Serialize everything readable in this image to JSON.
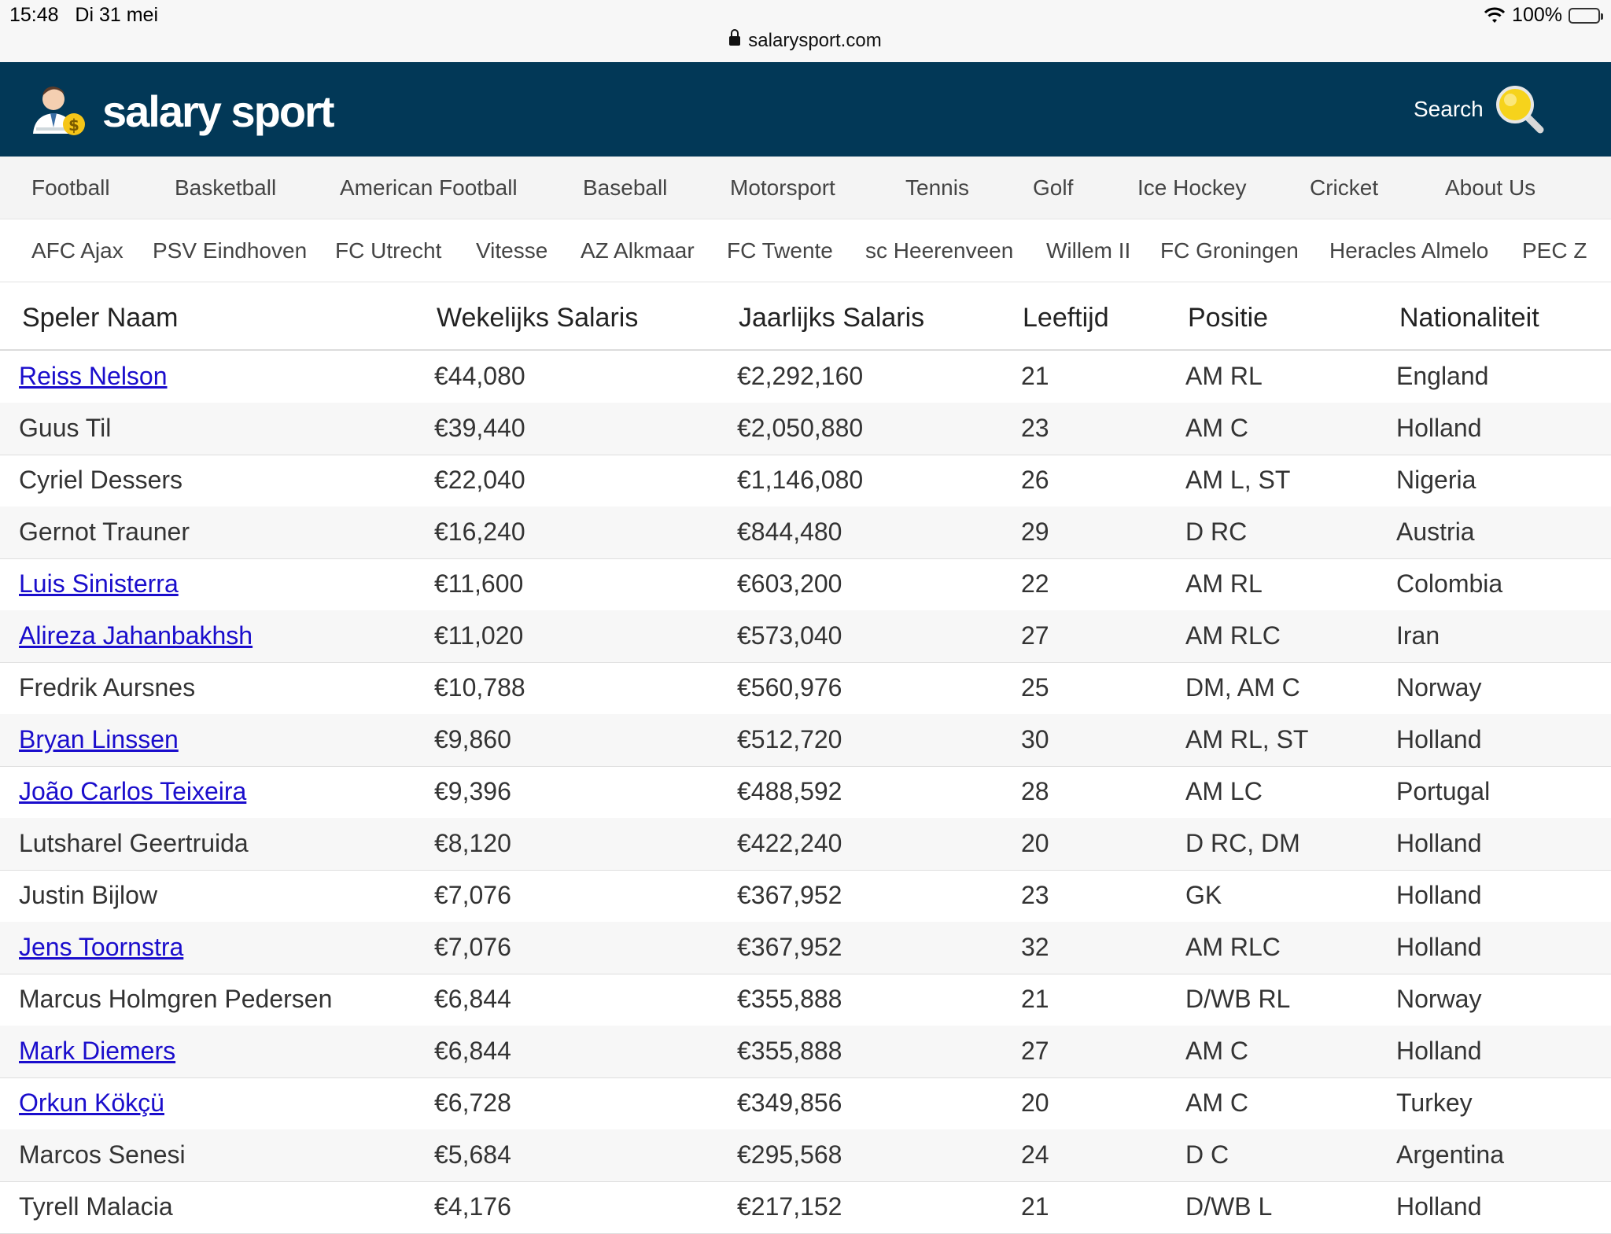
{
  "status_bar": {
    "time": "15:48",
    "date": "Di 31 mei",
    "battery": "100%",
    "url": "salarysport.com"
  },
  "header": {
    "logo_text": "salary sport",
    "search_label": "Search"
  },
  "nav_sports": [
    "Football",
    "Basketball",
    "American Football",
    "Baseball",
    "Motorsport",
    "Tennis",
    "Golf",
    "Ice Hockey",
    "Cricket",
    "About Us"
  ],
  "nav_clubs": [
    "AFC Ajax",
    "PSV Eindhoven",
    "FC Utrecht",
    "Vitesse",
    "AZ Alkmaar",
    "FC Twente",
    "sc Heerenveen",
    "Willem II",
    "FC Groningen",
    "Heracles Almelo",
    "PEC Z"
  ],
  "table": {
    "headers": [
      "Speler Naam",
      "Wekelijks Salaris",
      "Jaarlijks Salaris",
      "Leeftijd",
      "Positie",
      "Nationaliteit"
    ],
    "rows": [
      {
        "name": "Reiss Nelson",
        "link": true,
        "weekly": "€44,080",
        "yearly": "€2,292,160",
        "age": "21",
        "position": "AM RL",
        "nationality": "England"
      },
      {
        "name": "Guus Til",
        "link": false,
        "weekly": "€39,440",
        "yearly": "€2,050,880",
        "age": "23",
        "position": "AM C",
        "nationality": "Holland"
      },
      {
        "name": "Cyriel Dessers",
        "link": false,
        "weekly": "€22,040",
        "yearly": "€1,146,080",
        "age": "26",
        "position": "AM L, ST",
        "nationality": "Nigeria"
      },
      {
        "name": "Gernot Trauner",
        "link": false,
        "weekly": "€16,240",
        "yearly": "€844,480",
        "age": "29",
        "position": "D RC",
        "nationality": "Austria"
      },
      {
        "name": "Luis Sinisterra",
        "link": true,
        "weekly": "€11,600",
        "yearly": "€603,200",
        "age": "22",
        "position": "AM RL",
        "nationality": "Colombia"
      },
      {
        "name": "Alireza Jahanbakhsh",
        "link": true,
        "weekly": "€11,020",
        "yearly": "€573,040",
        "age": "27",
        "position": "AM RLC",
        "nationality": "Iran"
      },
      {
        "name": "Fredrik Aursnes",
        "link": false,
        "weekly": "€10,788",
        "yearly": "€560,976",
        "age": "25",
        "position": "DM, AM C",
        "nationality": "Norway"
      },
      {
        "name": "Bryan Linssen",
        "link": true,
        "weekly": "€9,860",
        "yearly": "€512,720",
        "age": "30",
        "position": "AM RL, ST",
        "nationality": "Holland"
      },
      {
        "name": "João Carlos Teixeira",
        "link": true,
        "weekly": "€9,396",
        "yearly": "€488,592",
        "age": "28",
        "position": "AM LC",
        "nationality": "Portugal"
      },
      {
        "name": "Lutsharel Geertruida",
        "link": false,
        "weekly": "€8,120",
        "yearly": "€422,240",
        "age": "20",
        "position": "D RC, DM",
        "nationality": "Holland"
      },
      {
        "name": "Justin Bijlow",
        "link": false,
        "weekly": "€7,076",
        "yearly": "€367,952",
        "age": "23",
        "position": "GK",
        "nationality": "Holland"
      },
      {
        "name": "Jens Toornstra",
        "link": true,
        "weekly": "€7,076",
        "yearly": "€367,952",
        "age": "32",
        "position": "AM RLC",
        "nationality": "Holland"
      },
      {
        "name": "Marcus Holmgren Pedersen",
        "link": false,
        "weekly": "€6,844",
        "yearly": "€355,888",
        "age": "21",
        "position": "D/WB RL",
        "nationality": "Norway"
      },
      {
        "name": "Mark Diemers",
        "link": true,
        "weekly": "€6,844",
        "yearly": "€355,888",
        "age": "27",
        "position": "AM C",
        "nationality": "Holland"
      },
      {
        "name": "Orkun Kökçü",
        "link": true,
        "weekly": "€6,728",
        "yearly": "€349,856",
        "age": "20",
        "position": "AM C",
        "nationality": "Turkey"
      },
      {
        "name": "Marcos Senesi",
        "link": false,
        "weekly": "€5,684",
        "yearly": "€295,568",
        "age": "24",
        "position": "D C",
        "nationality": "Argentina"
      },
      {
        "name": "Tyrell Malacia",
        "link": false,
        "weekly": "€4,176",
        "yearly": "€217,152",
        "age": "21",
        "position": "D/WB L",
        "nationality": "Holland"
      }
    ]
  }
}
